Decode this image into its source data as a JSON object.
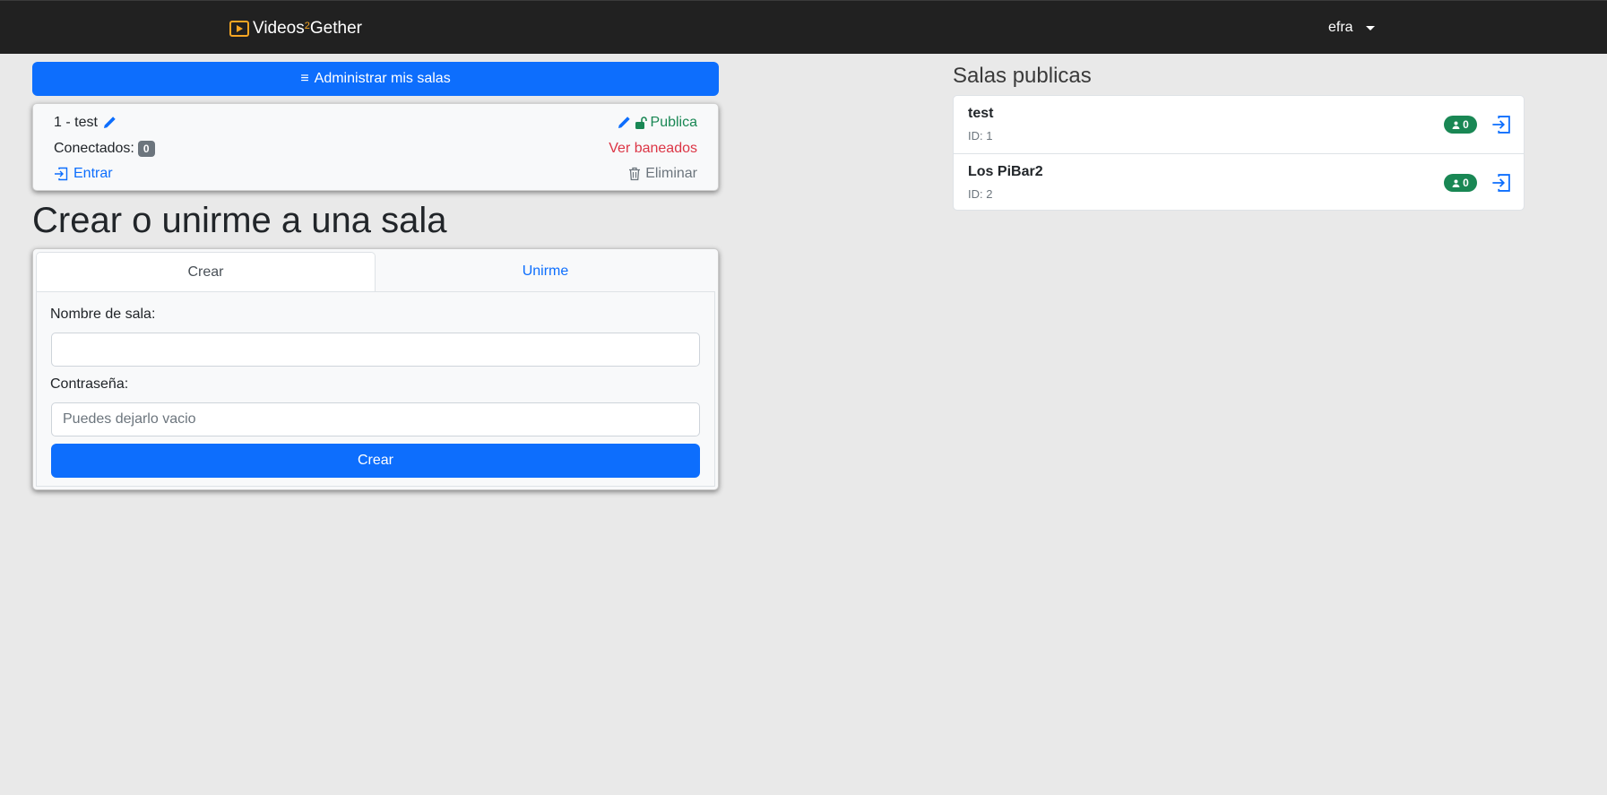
{
  "navbar": {
    "brand_main": "Videos",
    "brand_sup": "2",
    "brand_rest": "Gether",
    "user": "efra",
    "brand_color": "#f6a623"
  },
  "admin": {
    "label": "Administrar mis salas",
    "icon": "bars-icon"
  },
  "my_room": {
    "title": "1 - test",
    "connected_label": "Conectados:",
    "connected_count": "0",
    "enter_label": "Entrar",
    "visibility": "Publica",
    "banned_label": "Ver baneados",
    "delete_label": "Eliminar"
  },
  "create_section": {
    "title": "Crear o unirme a una sala",
    "tabs": [
      {
        "label": "Crear"
      },
      {
        "label": "Unirme"
      }
    ],
    "room_name_label": "Nombre de sala:",
    "room_name_value": "",
    "password_label": "Contraseña:",
    "password_placeholder": "Puedes dejarlo vacio",
    "submit_label": "Crear"
  },
  "public_rooms": {
    "title": "Salas publicas",
    "items": [
      {
        "name": "test",
        "id": "ID: 1",
        "users": "0"
      },
      {
        "name": "Los PiBar2",
        "id": "ID: 2",
        "users": "0"
      }
    ]
  },
  "colors": {
    "primary": "#0d6efd",
    "success": "#198754",
    "danger": "#dc3545",
    "secondary": "#6c757d",
    "navbar": "#212121"
  }
}
